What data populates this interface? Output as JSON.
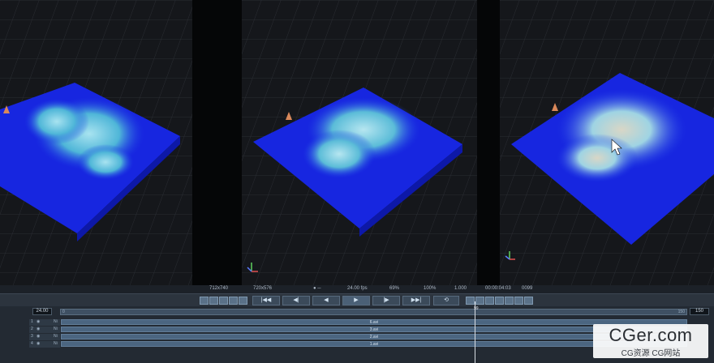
{
  "status_bar": {
    "resolution_a": "712x740",
    "resolution_b": "720x576",
    "fps": "24.00 fps",
    "zoom": "69%",
    "scale": "100%",
    "ratio": "1.000",
    "timecode": "00:00:04:03",
    "frame": "0099"
  },
  "timeline": {
    "start_frame": "24.00",
    "end_frame": "150",
    "ruler_start": "0",
    "ruler_end": "150",
    "playhead_label": "99",
    "layers": [
      {
        "index": "1",
        "tag": "Ni",
        "name": "6.avi"
      },
      {
        "index": "2",
        "tag": "Ni",
        "name": "3.avi"
      },
      {
        "index": "3",
        "tag": "Ni",
        "name": "2.avi"
      },
      {
        "index": "4",
        "tag": "Ni",
        "name": "1.avi"
      }
    ]
  },
  "playback": {
    "first_icon": "skip-to-start-icon",
    "prev_icon": "step-back-icon",
    "reverse_icon": "play-reverse-icon",
    "play_icon": "play-icon",
    "next_icon": "step-forward-icon",
    "last_icon": "skip-to-end-icon",
    "loop_icon": "loop-icon"
  },
  "watermark": {
    "main": "CGer.com",
    "sub": "CG资源 CG网站"
  },
  "colors": {
    "ocean": "#1a2ee6",
    "foam": "#7fd3e8",
    "ui_panel": "#2c343e"
  }
}
